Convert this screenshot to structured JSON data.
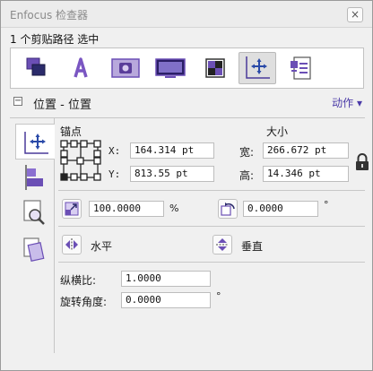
{
  "window": {
    "title": "Enfocus 检查器",
    "close_glyph": "×"
  },
  "selection": {
    "text": "1 个剪贴路径 选中"
  },
  "toolbar": {
    "items": [
      {
        "icon": "arrange-icon"
      },
      {
        "icon": "text-icon"
      },
      {
        "icon": "image-icon"
      },
      {
        "icon": "document-icon"
      },
      {
        "icon": "color-icon"
      },
      {
        "icon": "position-icon",
        "active": true
      },
      {
        "icon": "preflight-icon"
      }
    ]
  },
  "section": {
    "collapse_glyph": "−",
    "title": "位置 - 位置",
    "action_label": "动作 ▾"
  },
  "sidetabs": [
    "move-icon",
    "align-icon",
    "measure-icon",
    "transform-icon"
  ],
  "anchor": {
    "label": "锚点"
  },
  "size": {
    "label": "大小"
  },
  "coords": {
    "x_label": "X:",
    "x_value": "164.314 pt",
    "y_label": "Y:",
    "y_value": "813.55 pt",
    "w_label": "宽:",
    "w_value": "266.672 pt",
    "h_label": "高:",
    "h_value": "14.346 pt"
  },
  "scale": {
    "value": "100.0000",
    "unit": "%"
  },
  "rotate": {
    "value": "0.0000",
    "unit": "°"
  },
  "flip": {
    "horizontal": "水平",
    "vertical": "垂直"
  },
  "aspect": {
    "label": "纵横比:",
    "value": "1.0000"
  },
  "angle": {
    "label": "旋转角度:",
    "value": "0.0000",
    "unit": "°"
  },
  "colors": {
    "accent": "#6b4fb5",
    "link": "#4b3ba8"
  }
}
